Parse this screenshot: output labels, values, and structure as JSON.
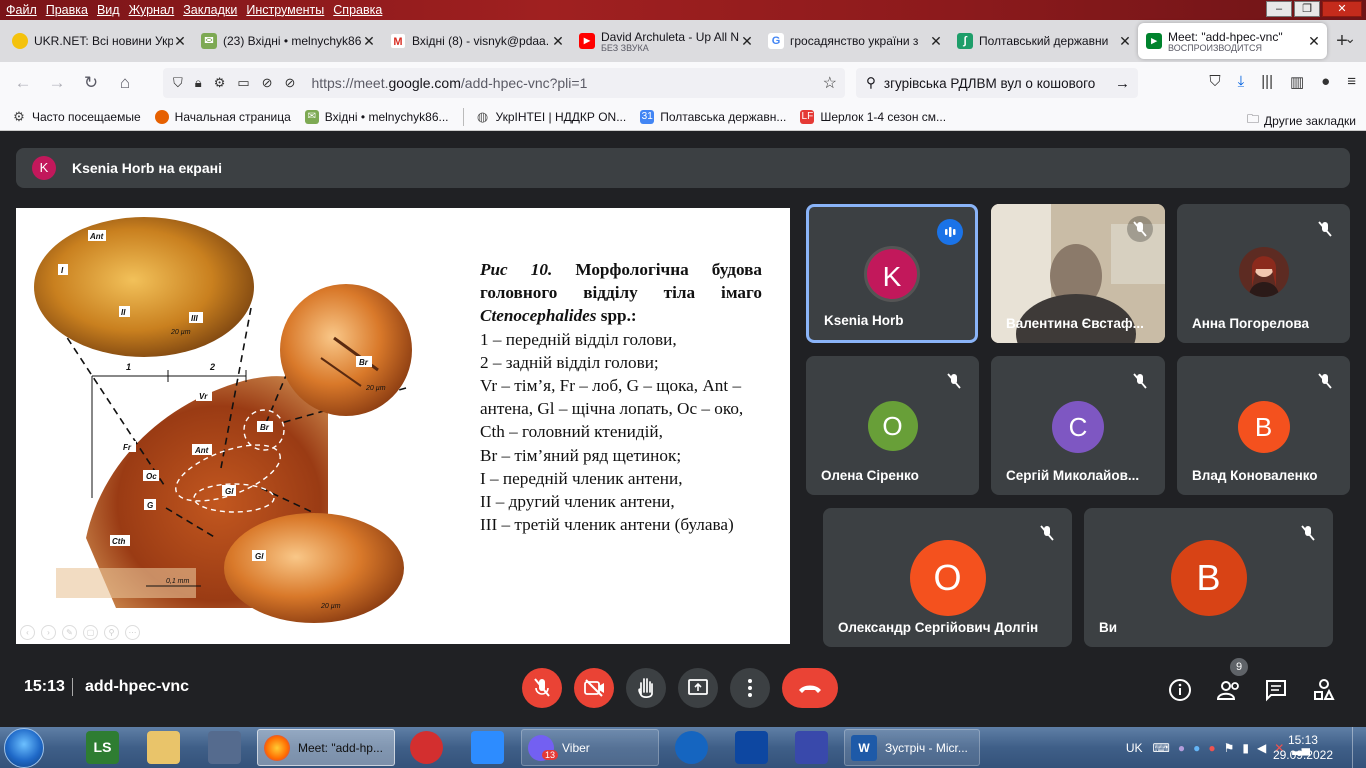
{
  "menu": [
    "Файл",
    "Правка",
    "Вид",
    "Журнал",
    "Закладки",
    "Инструменты",
    "Справка"
  ],
  "tabs": [
    {
      "label": "UKR.NET: Всі новини Укр",
      "icon_color": "#f4c20d",
      "icon": "ukrnet-icon"
    },
    {
      "label": "(23) Вхідні • melnychyk86",
      "icon_color": "#7da953",
      "icon": "mail-icon"
    },
    {
      "label": "Вхідні (8) - visnyk@pdaa.",
      "icon_color": "#d93025",
      "icon": "gmail-icon"
    },
    {
      "label": "David Archuleta - Up All N",
      "sub": "БЕЗ ЗВУКА",
      "icon_color": "#ff0000",
      "icon": "youtube-icon"
    },
    {
      "label": "гросадянство україни з",
      "icon_color": "#4285f4",
      "icon": "google-icon"
    },
    {
      "label": "Полтавський державни",
      "icon_color": "#1e9e6a",
      "icon": "site-icon"
    },
    {
      "label": "Meet: \"add-hpec-vnc\"",
      "sub": "ВОСПРОИЗВОДИТСЯ",
      "icon_color": "#00832d",
      "icon": "meet-icon",
      "active": true
    }
  ],
  "url": {
    "prefix": "https://meet.",
    "domain": "google.com",
    "path": "/add-hpec-vnc?pli=1"
  },
  "search": "згурівська РДЛВМ вул о кошового",
  "bookmarks": [
    {
      "label": "Часто посещаемые",
      "icon": "gear-icon",
      "color": "#444"
    },
    {
      "label": "Начальная страница",
      "icon": "firefox-icon",
      "color": "#e66000"
    },
    {
      "label": "Вхідні • melnychyk86...",
      "icon": "mail-icon",
      "color": "#7da953"
    },
    {
      "label": "УкрІНТЕІ | НДДКР ON...",
      "icon": "globe-icon",
      "color": "#555"
    },
    {
      "label": "Полтавська державн...",
      "icon": "calendar-icon",
      "color": "#4285f4"
    },
    {
      "label": "Шерлок 1-4 сезон см...",
      "icon": "lf-icon",
      "color": "#e53935"
    }
  ],
  "other_bookmarks": "Другие закладки",
  "presenter": {
    "initial": "K",
    "text": "Ksenia Horb на екрані"
  },
  "slide": {
    "title_fig": "Рис 10.",
    "title_rest": " Морфологічна будова головного відділу тіла імаго ",
    "title_species": "Ctenocephalides",
    "title_tail": " spp.:",
    "lines": [
      "1 – передній відділ голови,",
      "2 – задній відділ голови;",
      "Vr – тім’я, Fr – лоб, G – щока, Ant – антена, Gl – щічна лопать, Oc – око,",
      "Cth – головний ктенидій,",
      "Br – тім’яний ряд щетинок;",
      "I – передній членик антени,",
      "II – другий членик антени,",
      "III – третій членик антени (булава)"
    ],
    "labels": {
      "ant": "Ant",
      "i": "I",
      "ii": "II",
      "iii": "III",
      "scale20": "20 µm",
      "br": "Br",
      "one": "1",
      "two": "2",
      "vr": "Vr",
      "fr": "Fr",
      "oc": "Oc",
      "g": "G",
      "gl": "Gl",
      "cth": "Cth",
      "scale01": "0,1 mm"
    }
  },
  "participants": [
    {
      "name": "Ksenia Horb",
      "initial": "K",
      "color": "#c2185b",
      "speaking": true
    },
    {
      "name": "Валентина Євстаф...",
      "video": true
    },
    {
      "name": "Анна Погорелова",
      "photo": true
    },
    {
      "name": "Олена Сіренко",
      "initial": "О",
      "color": "#689f38"
    },
    {
      "name": "Сергій Миколайов...",
      "initial": "С",
      "color": "#7e57c2"
    },
    {
      "name": "Влад Коноваленко",
      "initial": "В",
      "color": "#f4511e"
    },
    {
      "name": "Олександр Сергійович Долгін",
      "initial": "О",
      "color": "#f4511e"
    },
    {
      "name": "Ви",
      "initial": "B",
      "color": "#d84315"
    }
  ],
  "bottom": {
    "time": "15:13",
    "code": "add-hpec-vnc",
    "people_count": "9"
  },
  "taskbar": {
    "items": [
      {
        "label": "Meet: \"add-hp...",
        "active": true
      },
      {
        "label": "Viber",
        "badge": "13"
      },
      {
        "label": "Зустріч - Micr..."
      }
    ],
    "lang": "UK",
    "time": "15:13",
    "date": "29.09.2022"
  }
}
